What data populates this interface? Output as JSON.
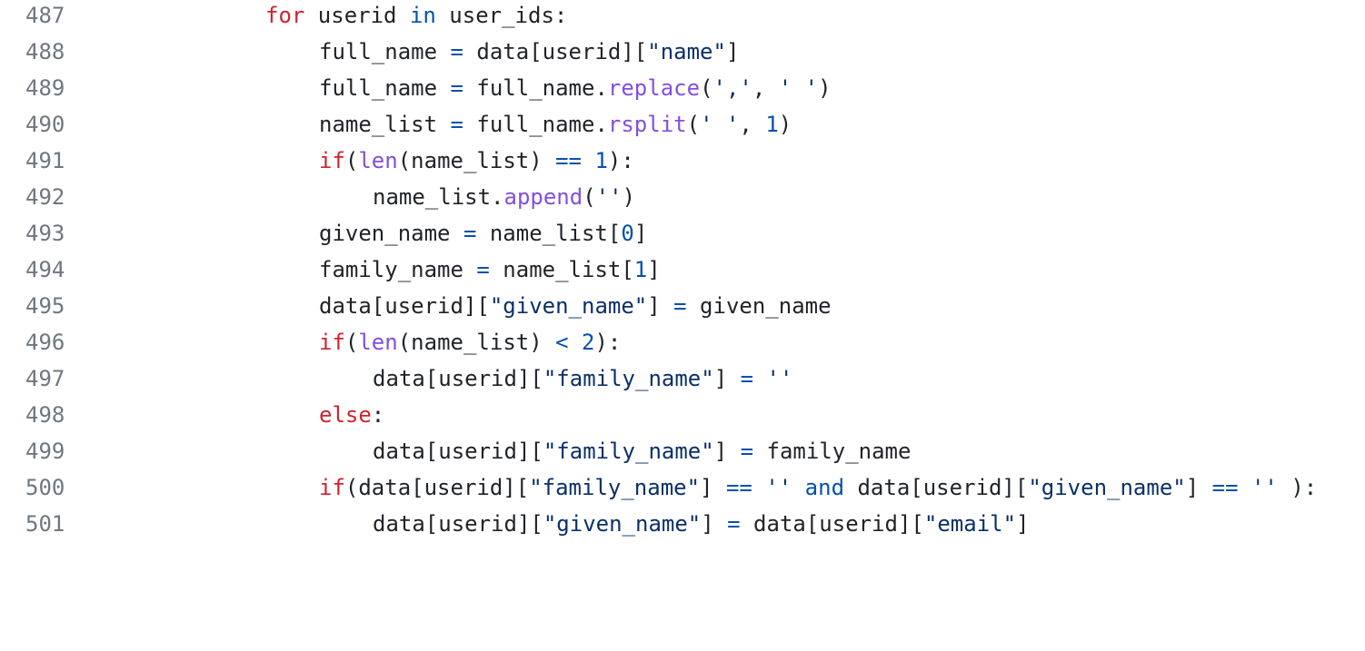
{
  "editor": {
    "theme": {
      "background": "#ffffff",
      "text": "#1f2328",
      "line_number": "#6e7781",
      "keyword": "#cf222e",
      "keyword_in_and": "#0550ae",
      "string": "#0a3069",
      "function": "#8250df",
      "number": "#0550ae",
      "operator": "#0550ae"
    },
    "lines": [
      {
        "number": "487",
        "tokens": [
          {
            "t": "for",
            "type": "keyword"
          },
          {
            "t": " userid ",
            "type": "plain"
          },
          {
            "t": "in",
            "type": "keyword2"
          },
          {
            "t": " user_ids:",
            "type": "plain"
          }
        ]
      },
      {
        "number": "488",
        "tokens": [
          {
            "t": "full_name ",
            "type": "plain"
          },
          {
            "t": "=",
            "type": "operator"
          },
          {
            "t": " data[userid][",
            "type": "plain"
          },
          {
            "t": "\"name\"",
            "type": "string"
          },
          {
            "t": "]",
            "type": "plain"
          }
        ]
      },
      {
        "number": "489",
        "tokens": [
          {
            "t": "full_name ",
            "type": "plain"
          },
          {
            "t": "=",
            "type": "operator"
          },
          {
            "t": " full_name.",
            "type": "plain"
          },
          {
            "t": "replace",
            "type": "func"
          },
          {
            "t": "(",
            "type": "plain"
          },
          {
            "t": "','",
            "type": "string"
          },
          {
            "t": ", ",
            "type": "plain"
          },
          {
            "t": "' '",
            "type": "string"
          },
          {
            "t": ")",
            "type": "plain"
          }
        ]
      },
      {
        "number": "490",
        "tokens": [
          {
            "t": "name_list ",
            "type": "plain"
          },
          {
            "t": "=",
            "type": "operator"
          },
          {
            "t": " full_name.",
            "type": "plain"
          },
          {
            "t": "rsplit",
            "type": "func"
          },
          {
            "t": "(",
            "type": "plain"
          },
          {
            "t": "' '",
            "type": "string"
          },
          {
            "t": ", ",
            "type": "plain"
          },
          {
            "t": "1",
            "type": "number"
          },
          {
            "t": ")",
            "type": "plain"
          }
        ]
      },
      {
        "number": "491",
        "tokens": [
          {
            "t": "if",
            "type": "keyword"
          },
          {
            "t": "(",
            "type": "plain"
          },
          {
            "t": "len",
            "type": "func"
          },
          {
            "t": "(name_list) ",
            "type": "plain"
          },
          {
            "t": "==",
            "type": "operator"
          },
          {
            "t": " ",
            "type": "plain"
          },
          {
            "t": "1",
            "type": "number"
          },
          {
            "t": "):",
            "type": "plain"
          }
        ]
      },
      {
        "number": "492",
        "tokens": [
          {
            "t": "name_list.",
            "type": "plain"
          },
          {
            "t": "append",
            "type": "func"
          },
          {
            "t": "(",
            "type": "plain"
          },
          {
            "t": "''",
            "type": "string"
          },
          {
            "t": ")",
            "type": "plain"
          }
        ]
      },
      {
        "number": "493",
        "tokens": [
          {
            "t": "given_name ",
            "type": "plain"
          },
          {
            "t": "=",
            "type": "operator"
          },
          {
            "t": " name_list[",
            "type": "plain"
          },
          {
            "t": "0",
            "type": "number"
          },
          {
            "t": "]",
            "type": "plain"
          }
        ]
      },
      {
        "number": "494",
        "tokens": [
          {
            "t": "family_name ",
            "type": "plain"
          },
          {
            "t": "=",
            "type": "operator"
          },
          {
            "t": " name_list[",
            "type": "plain"
          },
          {
            "t": "1",
            "type": "number"
          },
          {
            "t": "]",
            "type": "plain"
          }
        ]
      },
      {
        "number": "495",
        "tokens": [
          {
            "t": "data[userid][",
            "type": "plain"
          },
          {
            "t": "\"given_name\"",
            "type": "string"
          },
          {
            "t": "] ",
            "type": "plain"
          },
          {
            "t": "=",
            "type": "operator"
          },
          {
            "t": " given_name",
            "type": "plain"
          }
        ]
      },
      {
        "number": "496",
        "tokens": [
          {
            "t": "if",
            "type": "keyword"
          },
          {
            "t": "(",
            "type": "plain"
          },
          {
            "t": "len",
            "type": "func"
          },
          {
            "t": "(name_list) ",
            "type": "plain"
          },
          {
            "t": "<",
            "type": "operator"
          },
          {
            "t": " ",
            "type": "plain"
          },
          {
            "t": "2",
            "type": "number"
          },
          {
            "t": "):",
            "type": "plain"
          }
        ]
      },
      {
        "number": "497",
        "tokens": [
          {
            "t": "data[userid][",
            "type": "plain"
          },
          {
            "t": "\"family_name\"",
            "type": "string"
          },
          {
            "t": "] ",
            "type": "plain"
          },
          {
            "t": "=",
            "type": "operator"
          },
          {
            "t": " ",
            "type": "plain"
          },
          {
            "t": "''",
            "type": "string"
          }
        ]
      },
      {
        "number": "498",
        "tokens": [
          {
            "t": "else",
            "type": "keyword"
          },
          {
            "t": ":",
            "type": "plain"
          }
        ]
      },
      {
        "number": "499",
        "tokens": [
          {
            "t": "data[userid][",
            "type": "plain"
          },
          {
            "t": "\"family_name\"",
            "type": "string"
          },
          {
            "t": "] ",
            "type": "plain"
          },
          {
            "t": "=",
            "type": "operator"
          },
          {
            "t": " family_name",
            "type": "plain"
          }
        ]
      },
      {
        "number": "500",
        "tokens": [
          {
            "t": "if",
            "type": "keyword"
          },
          {
            "t": "(data[userid][",
            "type": "plain"
          },
          {
            "t": "\"family_name\"",
            "type": "string"
          },
          {
            "t": "] ",
            "type": "plain"
          },
          {
            "t": "==",
            "type": "operator"
          },
          {
            "t": " ",
            "type": "plain"
          },
          {
            "t": "''",
            "type": "string"
          },
          {
            "t": " ",
            "type": "plain"
          },
          {
            "t": "and",
            "type": "keyword2"
          },
          {
            "t": " data[userid][",
            "type": "plain"
          },
          {
            "t": "\"given_name\"",
            "type": "string"
          },
          {
            "t": "] ",
            "type": "plain"
          },
          {
            "t": "==",
            "type": "operator"
          },
          {
            "t": " ",
            "type": "plain"
          },
          {
            "t": "''",
            "type": "string"
          },
          {
            "t": " ):",
            "type": "plain"
          }
        ]
      },
      {
        "number": "501",
        "tokens": [
          {
            "t": "data[userid][",
            "type": "plain"
          },
          {
            "t": "\"given_name\"",
            "type": "string"
          },
          {
            "t": "] ",
            "type": "plain"
          },
          {
            "t": "=",
            "type": "operator"
          },
          {
            "t": " data[userid][",
            "type": "plain"
          },
          {
            "t": "\"email\"",
            "type": "string"
          },
          {
            "t": "]",
            "type": "plain"
          }
        ]
      }
    ]
  }
}
